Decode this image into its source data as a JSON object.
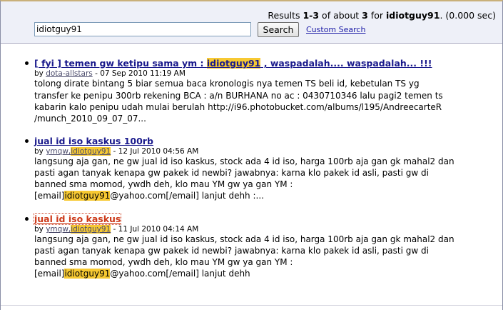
{
  "header": {
    "summary_prefix": "Results ",
    "range": "1-3",
    "summary_mid": " of about ",
    "total": "3",
    "summary_for": " for ",
    "query": "idiotguy91",
    "summary_time": ". (0.000 sec)"
  },
  "search": {
    "input_value": "idiotguy91",
    "button_label": "Search",
    "custom_search_label": "Custom Search"
  },
  "colors": {
    "link": "#1a1a8c",
    "visited_link": "#cc3a1a",
    "highlight": "#f7c932",
    "header_bg": "#eef0f8"
  },
  "results": [
    {
      "title_pre": "[ fyi ] temen gw ketipu sama ym : ",
      "title_hl": "idiotguy91",
      "title_post": " , waspadalah.... waspadalah... !!!",
      "by": "by ",
      "author": "dota-allstars",
      "author_hl": "",
      "date": " - 07 Sep 2010 11:19 AM",
      "lines": [
        {
          "pre": "tolong dirate bintang 5 biar semua baca kronologis nya temen TS beli id, kebetulan TS yg",
          "hl": "",
          "post": ""
        },
        {
          "pre": "transfer ke penipu 300rb rekening BCA : a/n BURHANA no ac : 0430710346 lalu pagi2 temen ts",
          "hl": "",
          "post": ""
        },
        {
          "pre": "kabarin kalo penipu udah mulai berulah http://i96.photobucket.com/albums/l195/AndreecarteR",
          "hl": "",
          "post": ""
        },
        {
          "pre": "/munch_2010_09_07_07...",
          "hl": "",
          "post": ""
        }
      ]
    },
    {
      "title_pre": "jual id iso kaskus 100rb",
      "title_hl": "",
      "title_post": "",
      "by": "by ",
      "author": "ymqw,",
      "author_hl": "idiotguy91",
      "date": " - 12 Jul 2010 04:56 AM",
      "lines": [
        {
          "pre": "langsung aja gan, ne gw jual id iso kaskus, stock ada 4 id iso, harga 100rb aja gan gk mahal2 dan",
          "hl": "",
          "post": ""
        },
        {
          "pre": "pasti agan tanyak kenapa gw pakek id newbi? jawabnya: karna klo pakek id asli, pasti gw di",
          "hl": "",
          "post": ""
        },
        {
          "pre": "banned sma momod, ywdh deh, klo mau YM gw ya gan YM :",
          "hl": "",
          "post": ""
        },
        {
          "pre": "[email]",
          "hl": "idiotguy91",
          "post": "@yahoo.com[/email] lanjut dehh :..."
        }
      ]
    },
    {
      "title_pre": "jual id iso kaskus",
      "title_hl": "",
      "title_post": "",
      "by": "by ",
      "author": "ymqw,",
      "author_hl": "idiotguy91",
      "date": " - 11 Jul 2010 04:14 AM",
      "lines": [
        {
          "pre": "langsung aja gan, ne gw jual id iso kaskus, stock ada 4 id iso, harga 100rb aja gan gk mahal2 dan",
          "hl": "",
          "post": ""
        },
        {
          "pre": "pasti agan tanyak kenapa gw pakek id newbi? jawabnya: karna klo pakek id asli, pasti gw di",
          "hl": "",
          "post": ""
        },
        {
          "pre": "banned sma momod, ywdh deh, klo mau YM gw ya gan YM :",
          "hl": "",
          "post": ""
        },
        {
          "pre": "[email]",
          "hl": "idiotguy91",
          "post": "@yahoo.com[/email] lanjut dehh"
        }
      ]
    }
  ]
}
